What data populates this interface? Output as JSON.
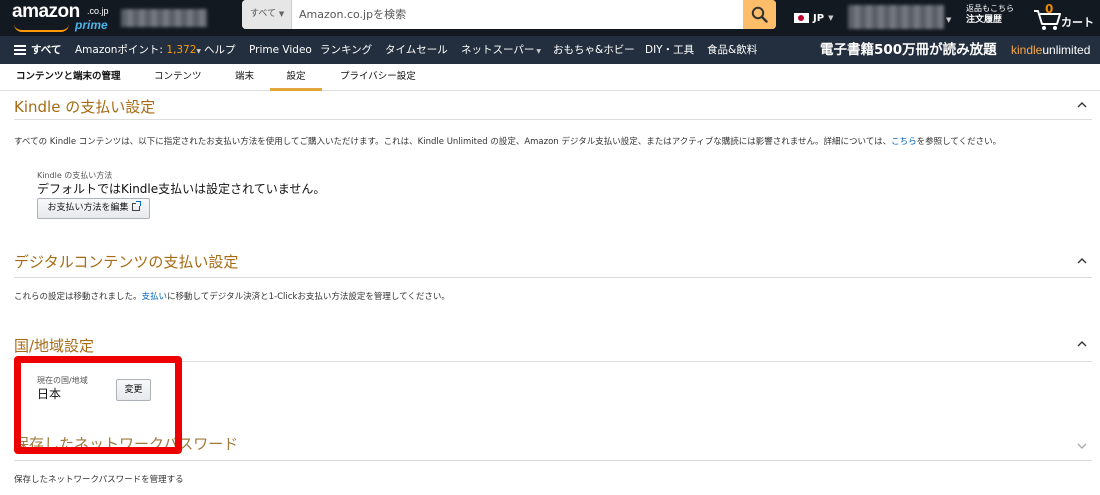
{
  "header": {
    "logo": {
      "word": "amazon",
      "tld": ".co.jp",
      "prime": "prime"
    },
    "search": {
      "category": "すべて",
      "placeholder": "Amazon.co.jpを検索"
    },
    "locale": {
      "label": "JP"
    },
    "orders": {
      "line1": "返品もこちら",
      "line2": "注文履歴"
    },
    "cart": {
      "count": "0",
      "label": "カート"
    }
  },
  "nav": {
    "all": "すべて",
    "points_label": "Amazonポイント: ",
    "points_value": "1,372",
    "items": [
      "ヘルプ",
      "Prime Video",
      "ランキング",
      "タイムセール",
      "ネットスーパー",
      "おもちゃ&ホビー",
      "DIY・工具",
      "食品&飲料"
    ],
    "promo": "電子書籍500万冊が読み放題",
    "kindle_unlimited": {
      "k": "kindle",
      "u": "unlimited"
    }
  },
  "subnav": {
    "title": "コンテンツと端末の管理",
    "tabs": [
      "コンテンツ",
      "端末",
      "設定",
      "プライバシー設定"
    ],
    "active_tab": "設定"
  },
  "sections": {
    "kindle_payment": {
      "title": "Kindle の支払い設定",
      "desc_pre": "すべての Kindle コンテンツは、以下に指定されたお支払い方法を使用してご購入いただけます。これは、Kindle Unlimited の設定、Amazon デジタル支払い設定、またはアクティブな購読には影響されません。詳細については、",
      "desc_link": "こちら",
      "desc_post": "を参照してください。",
      "field_label": "Kindle の支払い方法",
      "field_value": "デフォルトではKindle支払いは設定されていません。",
      "edit_button": "お支払い方法を編集"
    },
    "digital_payment": {
      "title": "デジタルコンテンツの支払い設定",
      "desc_pre": "これらの設定は移動されました。",
      "desc_link": "支払い",
      "desc_post": "に移動してデジタル決済と1-Clickお支払い方法設定を管理してください。"
    },
    "country": {
      "title": "国/地域設定",
      "field_label": "現在の国/地域",
      "field_value": "日本",
      "change_button": "変更"
    },
    "network_password": {
      "title": "保存したネットワークパスワード",
      "desc": "保存したネットワークパスワードを管理する"
    }
  },
  "colors": {
    "accent": "#a66b14",
    "link": "#0066c0",
    "highlight": "#e00000",
    "nav_bg": "#232f3e",
    "top_bg": "#131921"
  }
}
